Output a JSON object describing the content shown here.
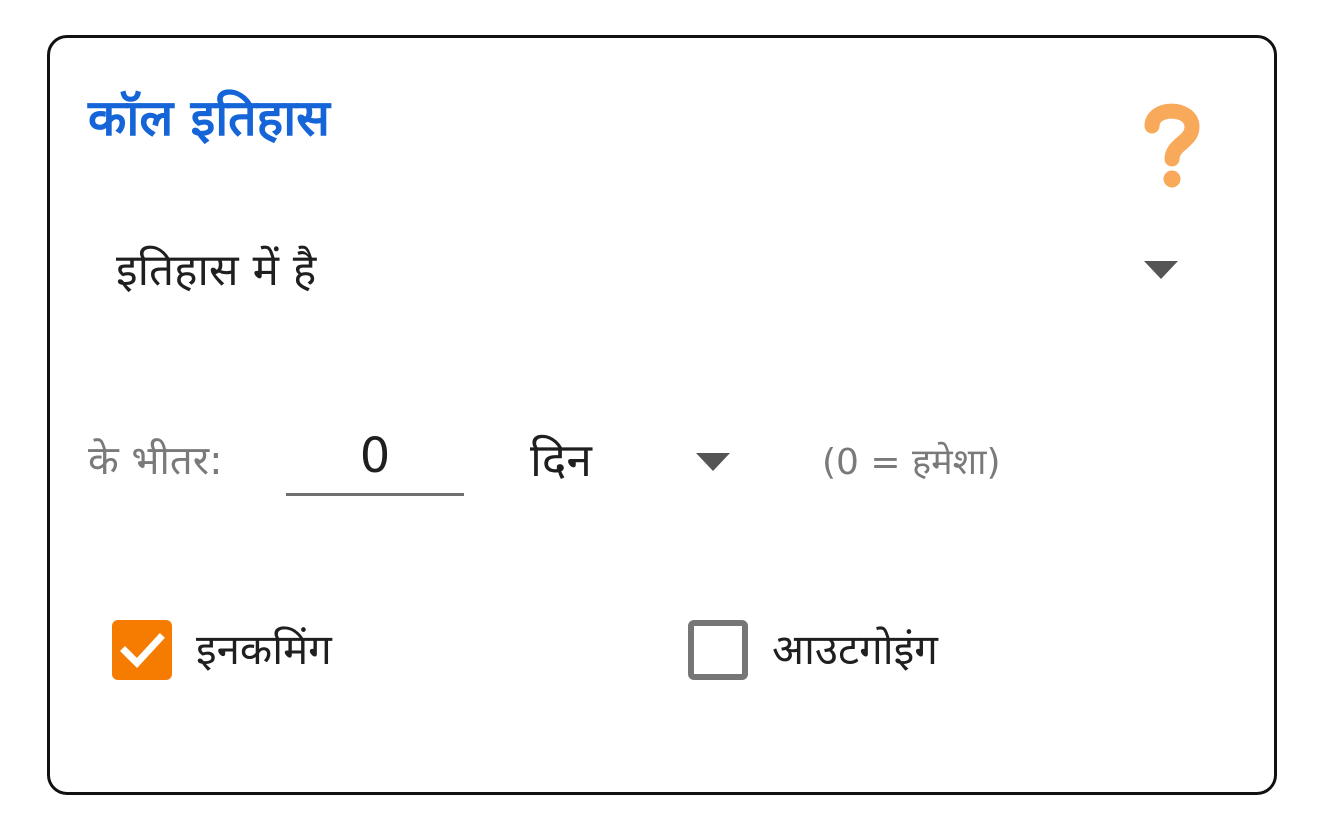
{
  "card": {
    "title": "कॉल इतिहास",
    "title_color": "#1565d8",
    "help_icon": "question-mark-icon",
    "help_icon_color": "#f8a95a"
  },
  "mode_select": {
    "value": "इतिहास में है",
    "caret_icon": "caret-down-icon"
  },
  "range": {
    "label": "के भीतर:",
    "value": "0",
    "unit_value": "दिन",
    "unit_caret_icon": "caret-down-icon",
    "hint": "(0 = हमेशा)"
  },
  "checkboxes": {
    "incoming": {
      "label": "इनकमिंग",
      "checked": true,
      "checked_color": "#f57c00"
    },
    "outgoing": {
      "label": "आउटगोइंग",
      "checked": false
    }
  }
}
